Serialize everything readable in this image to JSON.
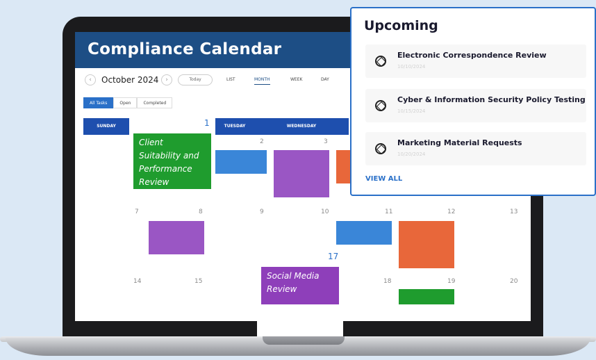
{
  "calendar": {
    "title": "Compliance Calendar",
    "month": "October 2024",
    "today_label": "Today",
    "prev_icon": "chevron-left-icon",
    "next_icon": "chevron-right-icon",
    "views": [
      "LIST",
      "MONTH",
      "WEEK",
      "DAY"
    ],
    "active_view": "MONTH",
    "filters": [
      "All Tasks",
      "Open",
      "Completed"
    ],
    "active_filter": "All Tasks",
    "day_headers": [
      "SUNDAY",
      "TUESDAY",
      "WEDNESDAY"
    ],
    "day_numbers": [
      "1",
      "2",
      "3",
      "7",
      "8",
      "9",
      "10",
      "11",
      "12",
      "13",
      "14",
      "15",
      "17",
      "18",
      "19",
      "20"
    ],
    "events": [
      {
        "title": "Client Suitability and Performance Review",
        "color": "#1f9c2e"
      },
      {
        "title": "Social Media Review",
        "color": "#8e3fba"
      },
      {
        "title": "",
        "color": "#3a86d8"
      },
      {
        "title": "",
        "color": "#9a56c4"
      },
      {
        "title": "",
        "color": "#e8673a"
      }
    ]
  },
  "upcoming": {
    "title": "Upcoming",
    "items": [
      {
        "name": "Electronic Correspondence Review",
        "date": "10/10/2024",
        "icon": "gear-icon"
      },
      {
        "name": "Cyber & Information Security Policy Testing",
        "date": "10/15/2024",
        "icon": "gear-icon"
      },
      {
        "name": "Marketing Material Requests",
        "date": "10/20/2024",
        "icon": "gear-icon"
      }
    ],
    "view_all": "VIEW ALL"
  },
  "colors": {
    "header": "#1d4e85",
    "accent": "#2a70c8",
    "green": "#1f9c2e",
    "purple": "#9a56c4",
    "blue": "#3a86d8",
    "orange": "#e8673a"
  }
}
